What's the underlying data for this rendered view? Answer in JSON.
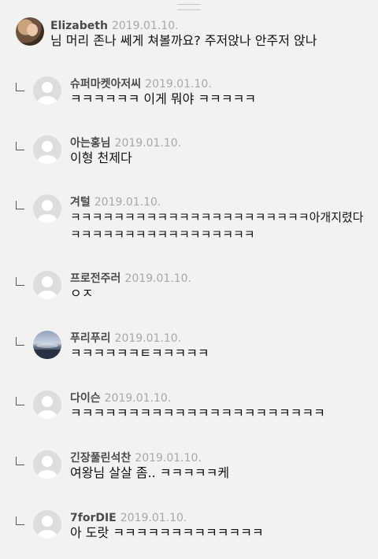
{
  "main_comment": {
    "author": "Elizabeth",
    "date": "2019.01.10.",
    "text": "님 머리 존나 쎄게 쳐볼까요? 주저앉나 안주저 앉나"
  },
  "replies": [
    {
      "author": "슈퍼마켓아저씨",
      "date": "2019.01.10.",
      "text": "ㅋㅋㅋㅋㅋㅋ 이게 뭐야 ㅋㅋㅋㅋㅋ",
      "avatar": "default-avatar-icon"
    },
    {
      "author": "아는홍님",
      "date": "2019.01.10.",
      "text": "이형 천제다",
      "avatar": "default-avatar-icon"
    },
    {
      "author": "겨털",
      "date": "2019.01.10.",
      "text_line1": "ㅋㅋㅋㅋㅋㅋㅋㅋㅋㅋㅋㅋㅋㅋㅋㅋㅋㅋㅋㅋㅋㅋ아개지렸다",
      "text_line2": "ㅋㅋㅋㅋㅋㅋㅋㅋㅋㅋㅋㅋㅋㅋㅋㅋㅋ",
      "avatar": "default-avatar-icon"
    },
    {
      "author": "프로전주러",
      "date": "2019.01.10.",
      "text": "ㅇㅈ",
      "avatar": "default-avatar-icon"
    },
    {
      "author": "푸리푸리",
      "date": "2019.01.10.",
      "text": "ㅋㅋㅋㅋㅋㅋㅌㅋㅋㅋㅋㅋ",
      "avatar": "landscape-photo-avatar"
    },
    {
      "author": "다이슨",
      "date": "2019.01.10.",
      "text": "ㅋㅋㅋㅋㅋㅋㅋㅋㅋㅋㅋㅋㅋㅋㅋㅋㅋㅋㅋㅋㅋㅋ",
      "avatar": "default-avatar-icon"
    },
    {
      "author": "긴장풀린석찬",
      "date": "2019.01.10.",
      "text": "여왕님 살살 좀.. ㅋㅋㅋㅋㅋ케",
      "avatar": "default-avatar-icon"
    },
    {
      "author": "7forDIE",
      "date": "2019.01.10.",
      "text": "아 도랏 ㅋㅋㅋㅋㅋㅋㅋㅋㅋㅋㅋㅋㅋ",
      "avatar": "default-avatar-icon"
    }
  ]
}
